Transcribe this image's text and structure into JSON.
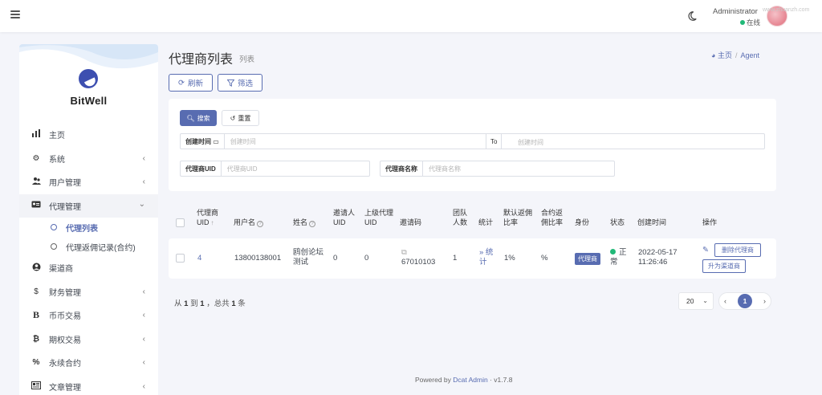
{
  "navbar": {
    "menu_icon": "hamburger-icon",
    "theme_icon": "moon-icon",
    "user_name": "Administrator",
    "status": "在线",
    "watermark": "www.zhuanzh.com"
  },
  "sidebar": {
    "brand": "BitWell",
    "items": [
      {
        "label": "主页",
        "icon": "bar-chart-icon",
        "glyph": "📊",
        "chevron": ""
      },
      {
        "label": "系统",
        "icon": "gear-icon",
        "glyph": "⚙",
        "chevron": "‹"
      },
      {
        "label": "用户管理",
        "icon": "users-icon",
        "glyph": "👥",
        "chevron": "‹"
      },
      {
        "label": "代理管理",
        "icon": "id-card-icon",
        "glyph": "▣",
        "chevron": "⌄"
      }
    ],
    "sub_items": [
      {
        "label": "代理列表",
        "active": true
      },
      {
        "label": "代理返佣记录(合约)",
        "active": false
      }
    ],
    "items_after": [
      {
        "label": "渠道商",
        "icon": "user-circle-icon",
        "glyph": "◉",
        "chevron": ""
      },
      {
        "label": "财务管理",
        "icon": "dollar-icon",
        "glyph": "$",
        "chevron": "‹"
      },
      {
        "label": "币币交易",
        "icon": "bold-b-icon",
        "glyph": "B",
        "chevron": "‹"
      },
      {
        "label": "期权交易",
        "icon": "bitcoin-icon",
        "glyph": "₿",
        "chevron": "‹"
      },
      {
        "label": "永续合约",
        "icon": "percent-icon",
        "glyph": "%",
        "chevron": "‹"
      },
      {
        "label": "文章管理",
        "icon": "newspaper-icon",
        "glyph": "▤",
        "chevron": "‹"
      }
    ]
  },
  "header": {
    "title": "代理商列表",
    "subtitle": "列表",
    "breadcrumb_home": "主页",
    "breadcrumb_current": "Agent"
  },
  "toolbar": {
    "refresh_label": "刷新",
    "filter_label": "筛选"
  },
  "filter": {
    "search_label": "搜索",
    "reset_label": "重置",
    "time_label": "创建时间",
    "time_placeholder": "创建时间",
    "to_label": "To",
    "time_end_placeholder": "创建时间",
    "uid_label": "代理商UID",
    "uid_placeholder": "代理商UID",
    "name_label": "代理商名称",
    "name_placeholder": "代理商名称"
  },
  "table": {
    "columns": {
      "uid_line1": "代理商",
      "uid_line2": "UID",
      "username": "用户名",
      "name": "姓名",
      "inviter_line1": "邀请人",
      "inviter_line2": "UID",
      "parent_line1": "上级代理",
      "parent_line2": "UID",
      "invite_code": "邀请码",
      "team_line1": "团队",
      "team_line2": "人数",
      "stats": "统计",
      "default_rate_line1": "默认返佣",
      "default_rate_line2": "比率",
      "contract_rate_line1": "合约返",
      "contract_rate_line2": "佣比率",
      "identity": "身份",
      "status": "状态",
      "created": "创建时间",
      "actions": "操作"
    },
    "row": {
      "uid": "4",
      "username": "13800138001",
      "name_line1": "鸥创论坛",
      "name_line2": "测试",
      "inviter_uid": "0",
      "parent_uid": "0",
      "invite_code": "67010103",
      "team_count": "1",
      "stats_line1": "» 统",
      "stats_line2": "计",
      "default_rate": "1%",
      "contract_rate": "%",
      "identity": "代理商",
      "status_line1": "正",
      "status_line2": "常",
      "created_line1": "2022-05-17",
      "created_line2": "11:26:46",
      "delete_label": "删除代理商",
      "upgrade_label": "升为渠道商"
    }
  },
  "pagination": {
    "from_prefix": "从",
    "from": "1",
    "to_prefix": "到",
    "to": "1",
    "total_prefix": "，总共",
    "total": "1",
    "total_suffix": "条",
    "per_page": "20",
    "current_page": "1",
    "prev": "‹",
    "next": "›"
  },
  "footer": {
    "prefix": "Powered by",
    "link": "Dcat Admin",
    "version": "· v1.7.8"
  },
  "colors": {
    "primary": "#586cb1",
    "success": "#21b978",
    "background": "#f4f5fa"
  }
}
